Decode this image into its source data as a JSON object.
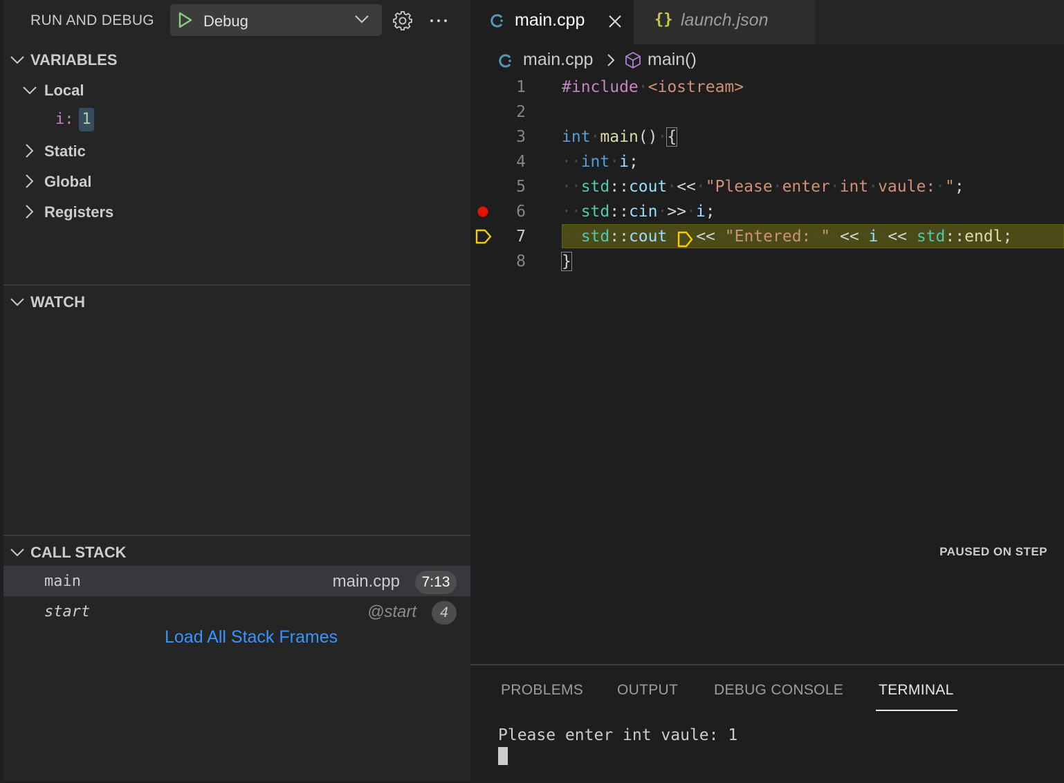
{
  "sidebar": {
    "title": "RUN AND DEBUG",
    "config_label": "Debug",
    "variables": {
      "heading": "VARIABLES",
      "local": "Local",
      "local_var": {
        "name": "i:",
        "value": "1"
      },
      "static": "Static",
      "global": "Global",
      "registers": "Registers"
    },
    "watch": {
      "heading": "WATCH"
    },
    "call_stack": {
      "heading": "CALL STACK",
      "status": "PAUSED ON STEP",
      "frames": [
        {
          "name": "main",
          "file": "main.cpp",
          "position": "7:13"
        },
        {
          "name": "start",
          "file": "@start",
          "position": "4"
        }
      ],
      "load_all": "Load All Stack Frames"
    }
  },
  "editor": {
    "tabs": [
      {
        "label": "main.cpp",
        "active": true
      },
      {
        "label": "launch.json",
        "active": false
      }
    ],
    "breadcrumb": {
      "file": "main.cpp",
      "symbol": "main()"
    },
    "line_numbers": [
      "1",
      "2",
      "3",
      "4",
      "5",
      "6",
      "7",
      "8"
    ],
    "lines": [
      "#include <iostream>",
      "",
      "int main() {",
      "  int i;",
      "  std::cout << \"Please enter int vaule: \";",
      "  std::cin >> i;",
      "  std::cout << \"Entered: \" << i << std::endl;",
      "}"
    ],
    "breakpoint_line": 6,
    "current_line": 7
  },
  "panel": {
    "tabs": [
      "PROBLEMS",
      "OUTPUT",
      "DEBUG CONSOLE",
      "TERMINAL"
    ],
    "active_tab": "TERMINAL",
    "terminal_output": "Please enter int vaule: 1"
  },
  "colors": {
    "accent_link": "#3794ff",
    "breakpoint": "#e51400",
    "current_line_bg": "#4b4b18",
    "debug_pointer": "#ffcc00"
  }
}
